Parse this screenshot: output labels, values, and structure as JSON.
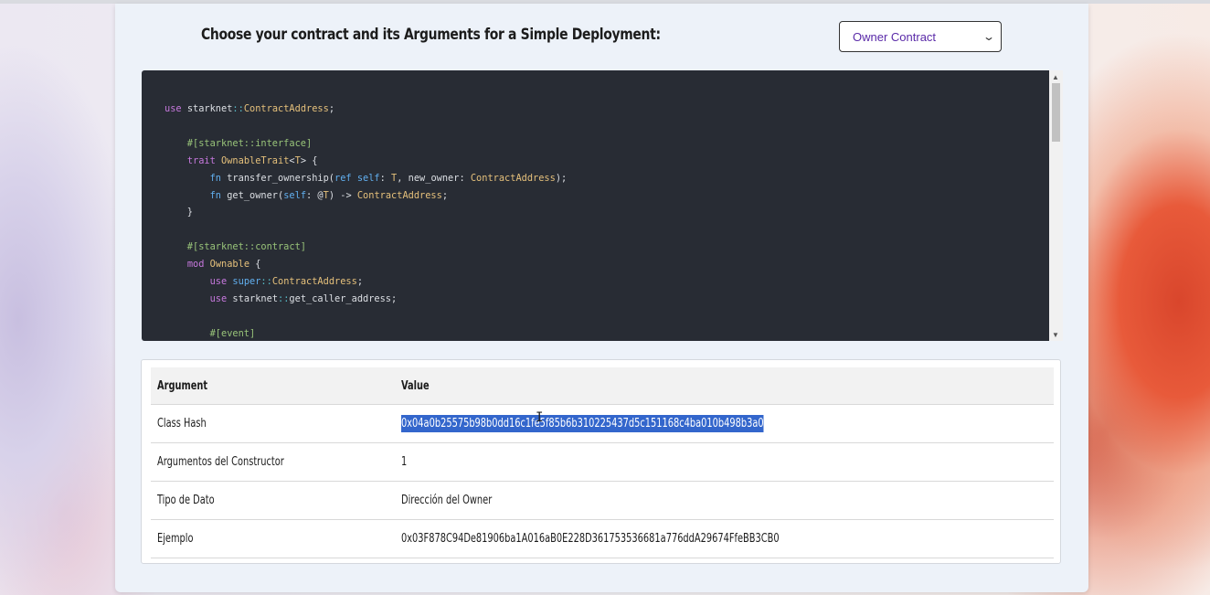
{
  "header": {
    "title": "Choose your contract and its Arguments for a Simple Deployment:",
    "contract_select": {
      "selected": "Owner Contract"
    }
  },
  "code_editor": {
    "lines": [
      "use starknet::ContractAddress;",
      "",
      "    #[starknet::interface]",
      "    trait OwnableTrait<T> {",
      "        fn transfer_ownership(ref self: T, new_owner: ContractAddress);",
      "        fn get_owner(self: @T) -> ContractAddress;",
      "    }",
      "",
      "    #[starknet::contract]",
      "    mod Ownable {",
      "        use super::ContractAddress;",
      "        use starknet::get_caller_address;",
      "",
      "        #[event]"
    ]
  },
  "table": {
    "headers": {
      "argument": "Argument",
      "value": "Value"
    },
    "rows": [
      {
        "argument": "Class Hash",
        "value": "0x04a0b25575b98b0dd16c1fe5f85b6b310225437d5c151168c4ba010b498b3a0"
      },
      {
        "argument": "Argumentos del Constructor",
        "value": "1"
      },
      {
        "argument": "Tipo de Dato",
        "value": "Dirección del Owner"
      },
      {
        "argument": "Ejemplo",
        "value": "0x03F878C94De81906ba1A016aB0E228D361753536681a776ddA29674FfeBB3CB0"
      }
    ]
  },
  "colors": {
    "code_background": "#282c34",
    "selection": "#3366cc",
    "select_text": "#5a2aa8"
  }
}
